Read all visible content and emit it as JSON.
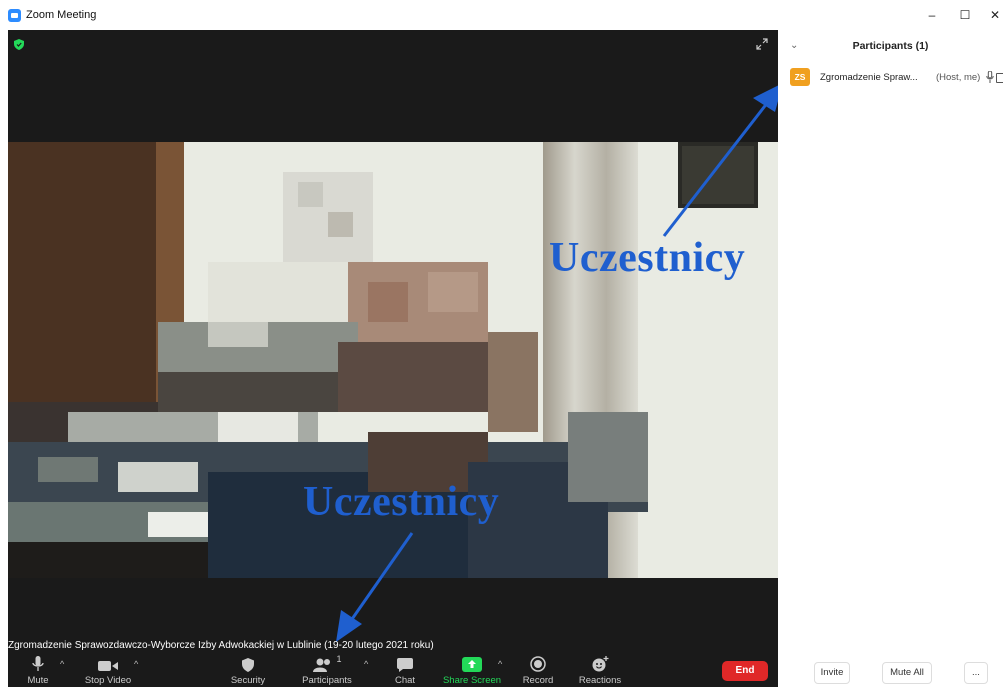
{
  "window": {
    "title": "Zoom Meeting",
    "minimize": "–",
    "maximize": "☐",
    "close": "✕"
  },
  "meeting": {
    "caption": "Zgromadzenie Sprawozdawczo-Wyborcze Izby Adwokackiej w Lublinie (19-20 lutego 2021 roku)"
  },
  "annotations": {
    "top_label": "Uczestnicy",
    "bottom_label": "Uczestnicy",
    "color": "#1f5fcf"
  },
  "toolbar": {
    "mute": "Mute",
    "stop_video": "Stop Video",
    "security": "Security",
    "participants": "Participants",
    "participants_count": "1",
    "chat": "Chat",
    "share_screen": "Share Screen",
    "record": "Record",
    "reactions": "Reactions",
    "end": "End",
    "share_color": "#23d959",
    "end_color": "#e02828"
  },
  "panel": {
    "title": "Participants (1)",
    "participant": {
      "initials": "ZS",
      "name": "Zgromadzenie Spraw...",
      "tag": "(Host, me)",
      "avatar_color": "#f0a020"
    },
    "invite": "Invite",
    "mute_all": "Mute All",
    "more": "..."
  }
}
